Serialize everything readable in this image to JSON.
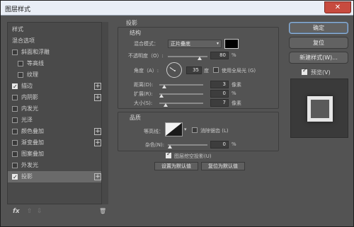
{
  "window": {
    "title": "图层样式",
    "close_glyph": "✕"
  },
  "sidebar": {
    "header_style": "样式",
    "header_blend": "混合选项",
    "items": [
      {
        "label": "斜面和浮雕",
        "checked": false,
        "plus": false
      },
      {
        "label": "等高线",
        "checked": false,
        "plus": false
      },
      {
        "label": "纹理",
        "checked": false,
        "plus": false
      },
      {
        "label": "描边",
        "checked": true,
        "plus": true
      },
      {
        "label": "内阴影",
        "checked": false,
        "plus": true
      },
      {
        "label": "内发光",
        "checked": false,
        "plus": false
      },
      {
        "label": "光泽",
        "checked": false,
        "plus": false
      },
      {
        "label": "颜色叠加",
        "checked": false,
        "plus": true
      },
      {
        "label": "渐变叠加",
        "checked": false,
        "plus": true
      },
      {
        "label": "图案叠加",
        "checked": false,
        "plus": false
      },
      {
        "label": "外发光",
        "checked": false,
        "plus": false
      },
      {
        "label": "投影",
        "checked": true,
        "plus": true
      }
    ],
    "plus_glyph": "+",
    "footer": {
      "fx": "fx",
      "up": "⇧",
      "down": "⇩",
      "trash": "🗑"
    }
  },
  "drop_shadow": {
    "title": "投影",
    "structure": {
      "title": "结构",
      "blend_mode_label": "混合模式：",
      "blend_mode_value": "正片叠底",
      "blend_arrow": "▾",
      "shadow_color": "#000000",
      "opacity_label": "不透明度（O）:",
      "opacity_value": "80",
      "opacity_unit": "%",
      "angle_label": "角度（A）:",
      "angle_value": "35",
      "angle_unit": "度",
      "global_light_label": "使用全局光 (G)",
      "global_light_checked": false,
      "distance_label": "距离(D):",
      "distance_value": "3",
      "distance_unit": "像素",
      "spread_label": "扩展(R):",
      "spread_value": "0",
      "spread_unit": "%",
      "size_label": "大小(S):",
      "size_value": "7",
      "size_unit": "像素"
    },
    "quality": {
      "title": "品质",
      "contour_label": "等高线：",
      "antialias_label": "消除锯齿 (L)",
      "antialias_checked": false,
      "noise_label": "杂色(N):",
      "noise_value": "0",
      "noise_unit": "%"
    },
    "knockout_label": "图层挖空投影(U)",
    "knockout_checked": true,
    "set_default_label": "设置为默认值",
    "reset_default_label": "复位为默认值"
  },
  "actions": {
    "ok": "确定",
    "reset": "复位",
    "new_style": "新建样式(W)...",
    "preview_label": "预览(V)",
    "preview_checked": true
  }
}
